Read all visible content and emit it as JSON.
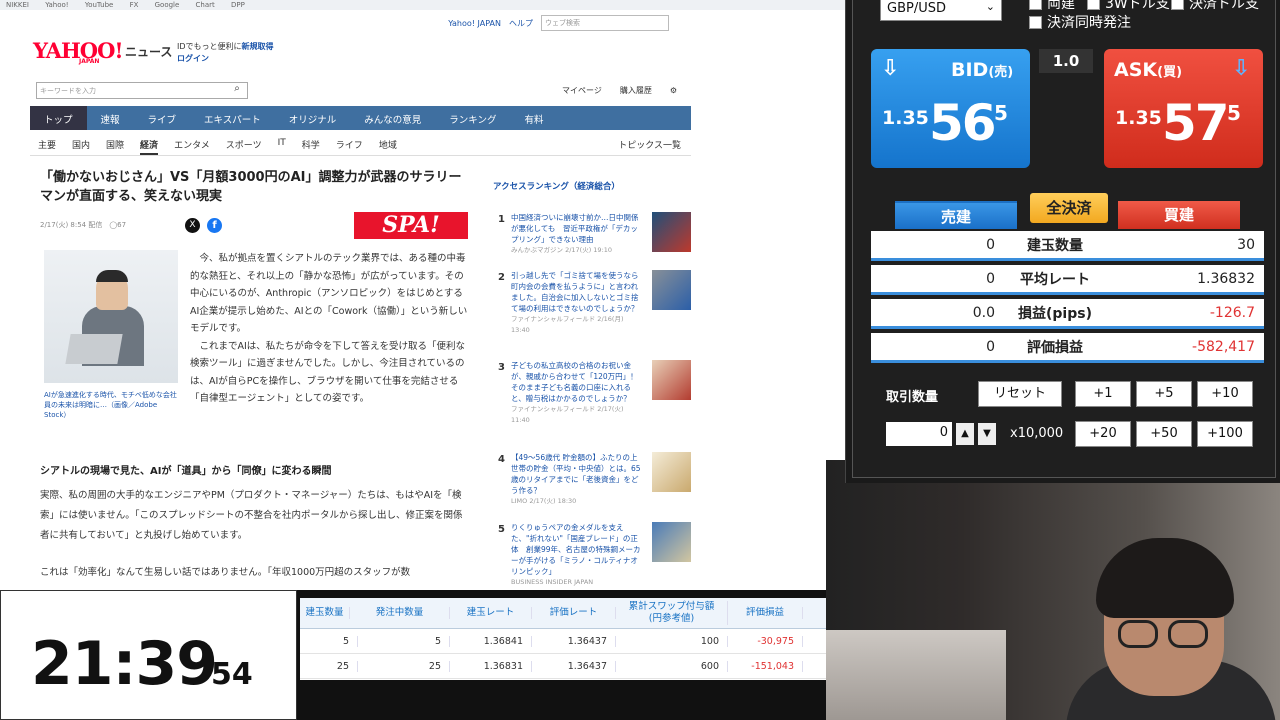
{
  "browser_tabs": [
    "NIKKEI",
    "Yahoo!",
    "YouTube",
    "FX",
    "Google",
    "Chart",
    "DPP"
  ],
  "yahoo": {
    "util": {
      "home": "Yahoo! JAPAN",
      "help": "ヘルプ",
      "web_search_placeholder": "ウェブ検索"
    },
    "logo": "YAHOO!",
    "logo_sub": "JAPAN",
    "news_label": "ニュース",
    "promo_line1": "IDでもっと便利に",
    "promo_link": "新規取得",
    "login": "ログイン",
    "search_placeholder": "キーワードを入力",
    "mypage": "マイページ",
    "history": "購入履歴",
    "nav": [
      "トップ",
      "速報",
      "ライブ",
      "エキスパート",
      "オリジナル",
      "みんなの意見",
      "ランキング",
      "有料"
    ],
    "subnav": [
      "主要",
      "国内",
      "国際",
      "経済",
      "エンタメ",
      "スポーツ",
      "IT",
      "科学",
      "ライフ",
      "地域"
    ],
    "topics": "トピックス一覧",
    "article": {
      "title": "「働かないおじさん」VS「月額3000円のAI」調整力が武器のサラリーマンが直面する、笑えない現実",
      "meta": "2/17(火) 8:54 配信　◯67",
      "publisher_logo": "SPA!",
      "caption": "AIが急速進化する時代、モチベ低めな会社員の未来は明暗に…（画像／Adobe Stock）",
      "body": "　今、私が拠点を置くシアトルのテック業界では、ある種の中毒的な熱狂と、それ以上の「静かな恐怖」が広がっています。その中心にいるのが、Anthropic（アンソロピック）をはじめとするAI企業が提示し始めた、AIとの「Cowork（協働）」という新しいモデルです。\n　これまでAIは、私たちが命令を下して答えを受け取る「便利な検索ツール」に過ぎませんでした。しかし、今注目されているのは、AIが自らPCを操作し、ブラウザを開いて仕事を完結させる「自律型エージェント」としての姿です。",
      "heading2": "シアトルの現場で見た、AIが「道具」から「同僚」に変わる瞬間",
      "body2": "実際、私の周囲の大手的なエンジニアやPM（プロダクト・マネージャー）たちは、もはやAIを「検索」には使いません。「このスプレッドシートの不整合を社内ポータルから探し出し、修正案を関係者に共有しておいて」と丸投げし始めています。",
      "body3": "これは「効率化」なんて生易しい話ではありません。「年収1000万円超のスタッフが数"
    },
    "ranking": {
      "title": "アクセスランキング（経済総合）",
      "items": [
        {
          "num": "1",
          "text": "中国経済ついに崩壊寸前か…日中関係が悪化しても　習近平政権が「デカップリング」できない理由",
          "src": "みんかぶマガジン 2/17(火) 19:10"
        },
        {
          "num": "2",
          "text": "引っ越し先で「ゴミ捨て場を使うなら町内会の会費を払うように」と言われました。自治会に加入しないとゴミ捨て場の利用はできないのでしょうか？",
          "src": "ファイナンシャルフィールド 2/16(月) 13:40"
        },
        {
          "num": "3",
          "text": "子どもの私立高校の合格のお祝い金が、親戚から合わせて「120万円」！ そのまま子ども名義の口座に入れると、贈与税はかかるのでしょうか？",
          "src": "ファイナンシャルフィールド 2/17(火) 11:40"
        },
        {
          "num": "4",
          "text": "【49～56歳代 貯金額の】ふたりの上世帯の貯金（平均・中央値）とは。65歳のリタイアまでに「老後資金」をどう作る？",
          "src": "LIMO 2/17(火) 18:30"
        },
        {
          "num": "5",
          "text": "りくりゅうペアの金メダルを支えた、\"折れない\"「国産ブレード」の正体　創業99年、名古屋の特殊鋼メーカーが手がける「ミラノ・コルティナオリンピック」",
          "src": "BUSINESS INSIDER JAPAN"
        }
      ]
    }
  },
  "timer": {
    "hm": "21:39",
    "sec": "54"
  },
  "positions": {
    "headers": [
      "建玉数量",
      "発注中数量",
      "建玉レート",
      "評価レート",
      "累計スワップ付与額\n(円参考値)",
      "評価損益"
    ],
    "rows": [
      [
        "5",
        "5",
        "1.36841",
        "1.36437",
        "100",
        "-30,975"
      ],
      [
        "25",
        "25",
        "1.36831",
        "1.36437",
        "600",
        "-151,043"
      ]
    ]
  },
  "trade": {
    "pair": "GBP/USD",
    "checkboxes": [
      "両建",
      "3Wドル支",
      "決済ドル支",
      "決済同時発注"
    ],
    "spread": "1.0",
    "bid": {
      "label": "BID",
      "sub": "(売)",
      "pre": "1.35",
      "big": "56",
      "pip": "5"
    },
    "ask": {
      "label": "ASK",
      "sub": "(買)",
      "pre": "1.35",
      "big": "57",
      "pip": "5"
    },
    "sell_tab": "売建",
    "close_all": "全決済",
    "buy_tab": "買建",
    "summary": [
      {
        "left": "0",
        "label": "建玉数量",
        "right": "30"
      },
      {
        "left": "0",
        "label": "平均レート",
        "right": "1.36832"
      },
      {
        "left": "0.0",
        "label": "損益(pips)",
        "right": "-126.7"
      },
      {
        "left": "0",
        "label": "評価損益",
        "right": "-582,417"
      }
    ],
    "lot_label": "取引数量",
    "reset": "リセット",
    "inc_row1": [
      "+1",
      "+5",
      "+10"
    ],
    "inc_row2": [
      "+20",
      "+50",
      "+100"
    ],
    "qty": "0",
    "multiplier": "x10,000"
  },
  "colors": {
    "bid": "#1b7fd8",
    "ask": "#e03a2a",
    "nav": "#3f6fa0",
    "negative": "#e03333"
  }
}
